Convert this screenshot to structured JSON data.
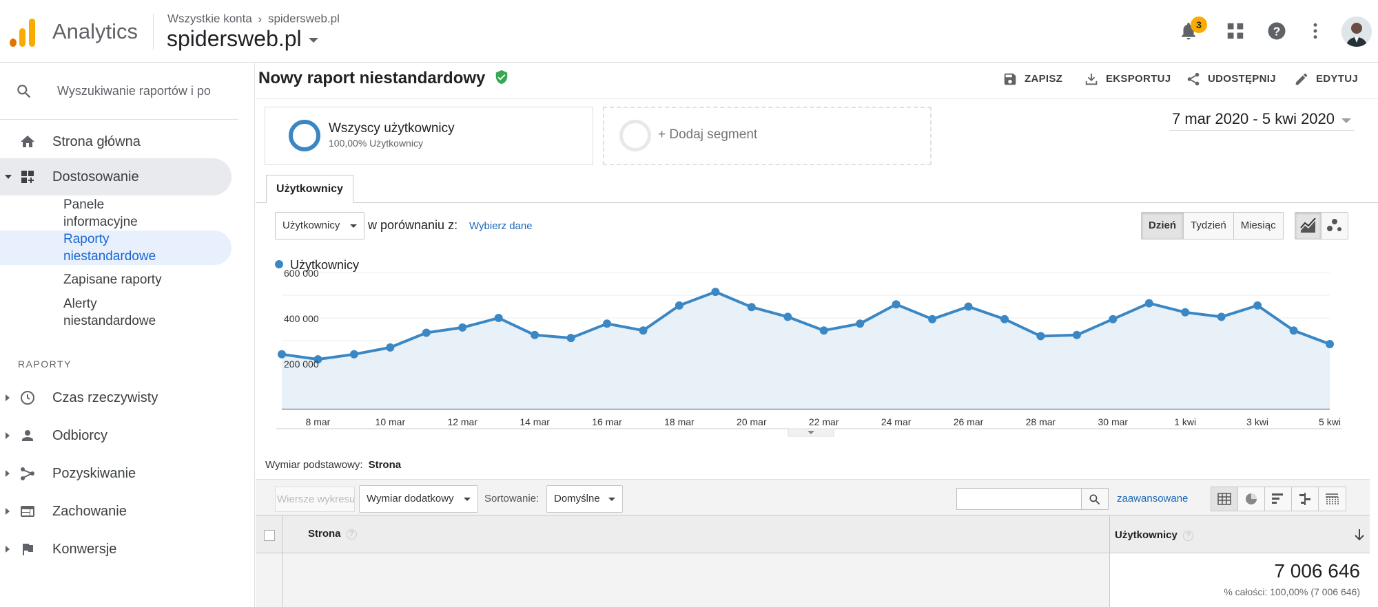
{
  "header": {
    "app_title": "Analytics",
    "breadcrumb_account": "Wszystkie konta",
    "breadcrumb_property": "spidersweb.pl",
    "account_selector": "spidersweb.pl",
    "notification_count": "3"
  },
  "sidebar": {
    "search_placeholder": "Wyszukiwanie raportów i po",
    "home": "Strona główna",
    "customization": "Dostosowanie",
    "sub_items": [
      "Panele informacyjne",
      "Raporty niestandardowe",
      "Zapisane raporty",
      "Alerty niestandardowe"
    ],
    "reports_section": "RAPORTY",
    "reports": [
      "Czas rzeczywisty",
      "Odbiorcy",
      "Pozyskiwanie",
      "Zachowanie",
      "Konwersje"
    ]
  },
  "report": {
    "title": "Nowy raport niestandardowy",
    "actions": {
      "save": "ZAPISZ",
      "export": "EKSPORTUJ",
      "share": "UDOSTĘPNIJ",
      "edit": "EDYTUJ"
    },
    "segment": {
      "name": "Wszyscy użytkownicy",
      "detail": "100,00% Użytkownicy",
      "add": "+ Dodaj segment"
    },
    "date_range": "7 mar 2020 - 5 kwi 2020",
    "tab": "Użytkownicy",
    "metric_select": "Użytkownicy",
    "compare_label": "w porównaniu z:",
    "choose_data": "Wybierz dane",
    "granularity": {
      "day": "Dzień",
      "week": "Tydzień",
      "month": "Miesiąc",
      "selected": "Dzień"
    }
  },
  "chart_data": {
    "type": "area",
    "series": [
      {
        "name": "Użytkownicy",
        "color": "#3b87c4",
        "values": [
          240000,
          218000,
          240000,
          270000,
          335000,
          358000,
          400000,
          325000,
          312000,
          375000,
          345000,
          455000,
          515000,
          448000,
          405000,
          345000,
          375000,
          460000,
          395000,
          450000,
          395000,
          320000,
          325000,
          395000,
          465000,
          425000,
          405000,
          455000,
          345000,
          285000
        ]
      }
    ],
    "x_tick_labels": [
      "8 mar",
      "10 mar",
      "12 mar",
      "14 mar",
      "16 mar",
      "18 mar",
      "20 mar",
      "22 mar",
      "24 mar",
      "26 mar",
      "28 mar",
      "30 mar",
      "1 kwi",
      "3 kwi",
      "5 kwi"
    ],
    "y_tick_labels": [
      "600 000",
      "400 000",
      "200 000"
    ],
    "ylim": [
      0,
      600000
    ],
    "legend": "top-left",
    "grid": true
  },
  "table": {
    "primary_dimension_label": "Wymiar podstawowy:",
    "primary_dimension": "Strona",
    "rows_button": "Wiersze wykresu",
    "secondary_dimension": "Wymiar dodatkowy",
    "sort_label": "Sortowanie:",
    "sort_value": "Domyślne",
    "advanced": "zaawansowane",
    "col_page": "Strona",
    "col_users": "Użytkownicy",
    "total_users": "7 006 646",
    "total_share": "% całości: 100,00% (7 006 646)"
  }
}
